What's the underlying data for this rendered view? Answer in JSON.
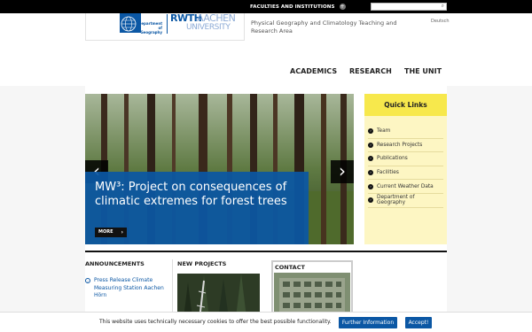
{
  "topbar": {
    "faculties_label": "FACULTIES AND INSTITUTIONS",
    "search_placeholder": ""
  },
  "header": {
    "logo": {
      "dept_line1": "Department",
      "dept_line2": "of Geography",
      "rwth": "RWTH",
      "aachen": "AACHEN",
      "university": "UNIVERSITY"
    },
    "site_title": "Physical Geography and Climatology Teaching and Research Area",
    "language_link": "Deutsch"
  },
  "nav": {
    "items": [
      "ACADEMICS",
      "RESEARCH",
      "THE UNIT"
    ]
  },
  "hero": {
    "title": "MW³: Project on consequences of climatic extremes for forest trees",
    "more_label": "MORE",
    "prev_icon": "chevron-left-icon",
    "next_icon": "chevron-right-icon"
  },
  "quick_links": {
    "heading": "Quick Links",
    "items": [
      "Team",
      "Research Projects",
      "Publications",
      "Facilities",
      "Current Weather Data",
      "Department of Geography"
    ]
  },
  "sections": {
    "announcements": {
      "heading": "ANNOUNCEMENTS",
      "items": [
        "Press Release Climate Measuring Station Aachen Hörn"
      ]
    },
    "new_projects": {
      "heading": "NEW PROJECTS"
    },
    "contact": {
      "heading": "CONTACT"
    }
  },
  "cookie": {
    "text": "This website uses technically necessary cookies to offer the best possible functionality.",
    "info_button": "Further Information",
    "accept_button": "Accept!"
  },
  "colors": {
    "brand_blue": "#0b57a4",
    "quick_links_yellow": "#f7e84c",
    "quick_links_bg": "#fdf6c3"
  }
}
